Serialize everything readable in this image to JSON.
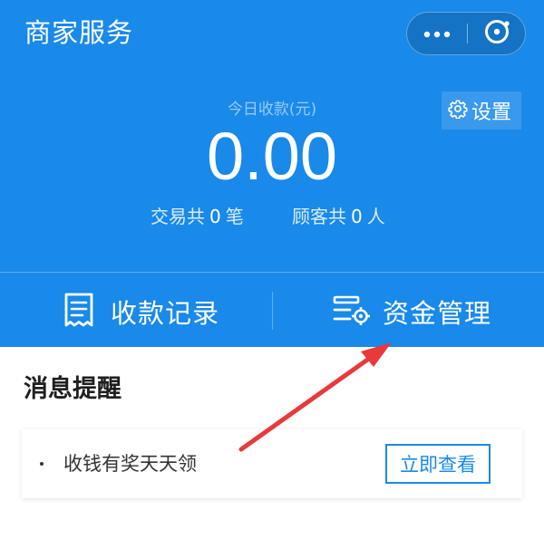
{
  "app": {
    "title": "商家服务"
  },
  "capsule": {
    "more_icon": "more-dots-icon",
    "close_icon": "close-circle-icon"
  },
  "settings": {
    "label": "设置",
    "icon": "gear-icon"
  },
  "summary": {
    "today_label": "今日收款(元)",
    "amount": "0.00",
    "transactions_prefix": "交易共",
    "transactions_count": "0",
    "transactions_unit": "笔",
    "customers_prefix": "顾客共",
    "customers_count": "0",
    "customers_unit": "人"
  },
  "actions": {
    "records_label": "收款记录",
    "records_icon": "receipt-icon",
    "funds_label": "资金管理",
    "funds_icon": "fund-settings-icon"
  },
  "messages": {
    "title": "消息提醒",
    "items": [
      {
        "text": "收钱有奖天天领",
        "button_label": "立即查看"
      }
    ]
  },
  "annotation": {
    "arrow_color": "#e8393b"
  },
  "colors": {
    "brand_blue": "#1989ea",
    "white": "#ffffff",
    "annotation_red": "#e8393b"
  }
}
